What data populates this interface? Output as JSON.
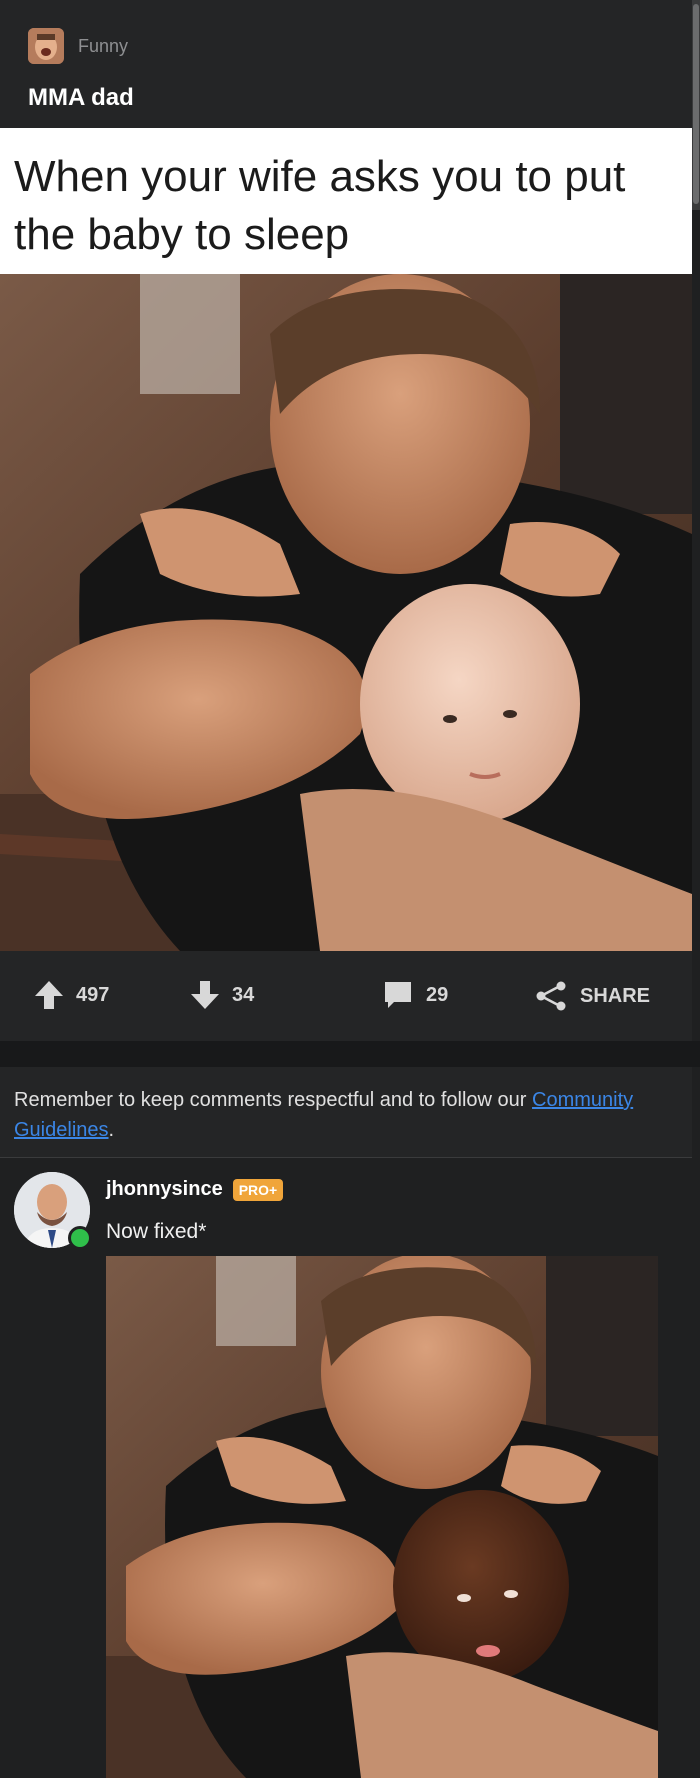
{
  "post": {
    "category": "Funny",
    "title": "MMA dad",
    "meme_caption": "When your wife asks you to put the baby to sleep"
  },
  "actions": {
    "upvotes": "497",
    "downvotes": "34",
    "comments": "29",
    "share_label": "SHARE"
  },
  "notice": {
    "text": "Remember to keep comments respectful and to follow our ",
    "link": "Community Guidelines",
    "suffix": "."
  },
  "comment": {
    "username": "jhonnysince",
    "badge": "PRO+",
    "text": "Now fixed*"
  },
  "colors": {
    "background": "#1f2021",
    "panel": "#242526",
    "link": "#3b86e6",
    "badge": "#f0a53a",
    "online": "#2fbf4a"
  }
}
